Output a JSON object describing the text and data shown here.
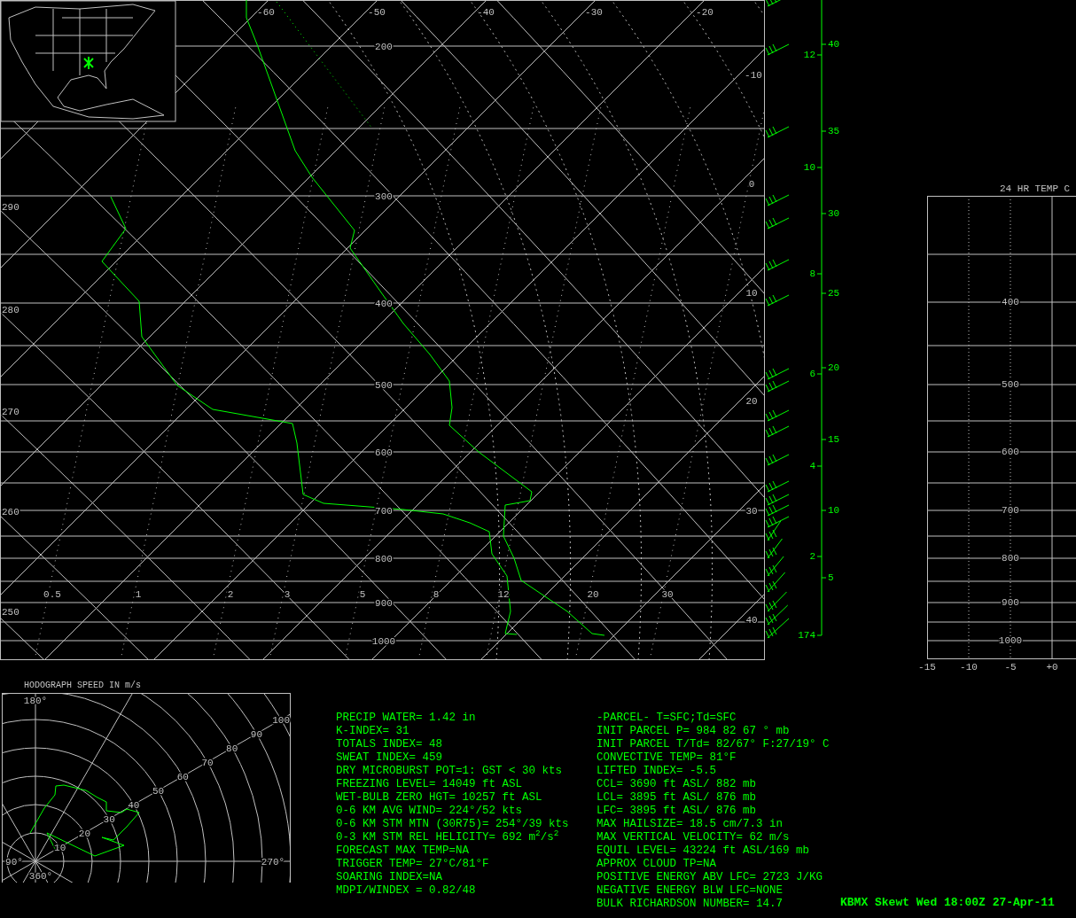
{
  "skewt": {
    "isotherm_labels": [
      "-60",
      "-50",
      "-40",
      "-30",
      "-20",
      "-10",
      "0",
      "10",
      "20",
      "30",
      "40"
    ],
    "pressure_labels": [
      "200",
      "300",
      "400",
      "500",
      "600",
      "700",
      "800",
      "900",
      "1000"
    ],
    "theta_labels": [
      "290",
      "280",
      "270",
      "260",
      "250"
    ],
    "mixing_ratio_labels": [
      "0.5",
      "1",
      "2",
      "3",
      "5",
      "8",
      "12",
      "20",
      "30"
    ],
    "height_km_labels": [
      "12",
      "10",
      "8",
      "6",
      "4",
      "2",
      "174"
    ],
    "height_kft_labels": [
      "40",
      "35",
      "30",
      "25",
      "20",
      "15",
      "10",
      "5"
    ]
  },
  "temp_change_chart": {
    "title": "24 HR TEMP C",
    "pressure_labels": [
      "400",
      "500",
      "600",
      "700",
      "800",
      "900",
      "1000"
    ],
    "x_ticks": [
      "-15",
      "-10",
      "-5",
      "+0"
    ]
  },
  "hodograph": {
    "title": "HODOGRAPH SPEED IN m/s",
    "direction_labels": [
      "180°",
      "90°",
      "270°",
      "360°"
    ],
    "speed_labels": [
      "10",
      "20",
      "30",
      "40",
      "50",
      "60",
      "70",
      "80",
      "90",
      "100"
    ]
  },
  "indices": [
    "PRECIP WATER= 1.42 in",
    "K-INDEX= 31",
    "TOTALS INDEX= 48",
    "SWEAT INDEX= 459",
    "DRY MICROBURST POT=1: GST < 30 kts",
    "FREEZING LEVEL= 14049 ft ASL",
    "WET-BULB ZERO HGT= 10257 ft ASL",
    "0-6 KM AVG WIND= 224°/52 kts",
    "0-6 KM STM MTN (30R75)= 254°/39 kts",
    "0-3 KM STM REL HELICITY= 692 m$^{2}$/s$^{2}$",
    "FORECAST MAX TEMP=NA",
    "TRIGGER TEMP= 27°C/81°F",
    "SOARING INDEX=NA",
    "MDPI/WINDEX = 0.82/48"
  ],
  "parcel": [
    "-PARCEL- T=SFC;Td=SFC",
    "INIT PARCEL P= 984 82 67 ° mb",
    "INIT PARCEL T/Td= 82/67° F:27/19° C",
    "CONVECTIVE TEMP= 81°F",
    "LIFTED INDEX= -5.5",
    "CCL= 3690 ft ASL/ 882 mb",
    "LCL= 3895 ft ASL/ 876 mb",
    "LFC= 3895 ft ASL/ 876 mb",
    "MAX HAILSIZE= 18.5 cm/7.3 in",
    "MAX VERTICAL VELOCITY= 62 m/s",
    "EQUIL LEVEL= 43224 ft ASL/169 mb",
    "APPROX CLOUD TP=NA",
    "POSITIVE ENERGY ABV LFC= 2723 J/KG",
    "NEGATIVE ENERGY BLW LFC=NONE",
    "BULK RICHARDSON NUMBER= 14.7"
  ],
  "title": "KBMX Skewt Wed 18:00Z 27-Apr-11"
}
